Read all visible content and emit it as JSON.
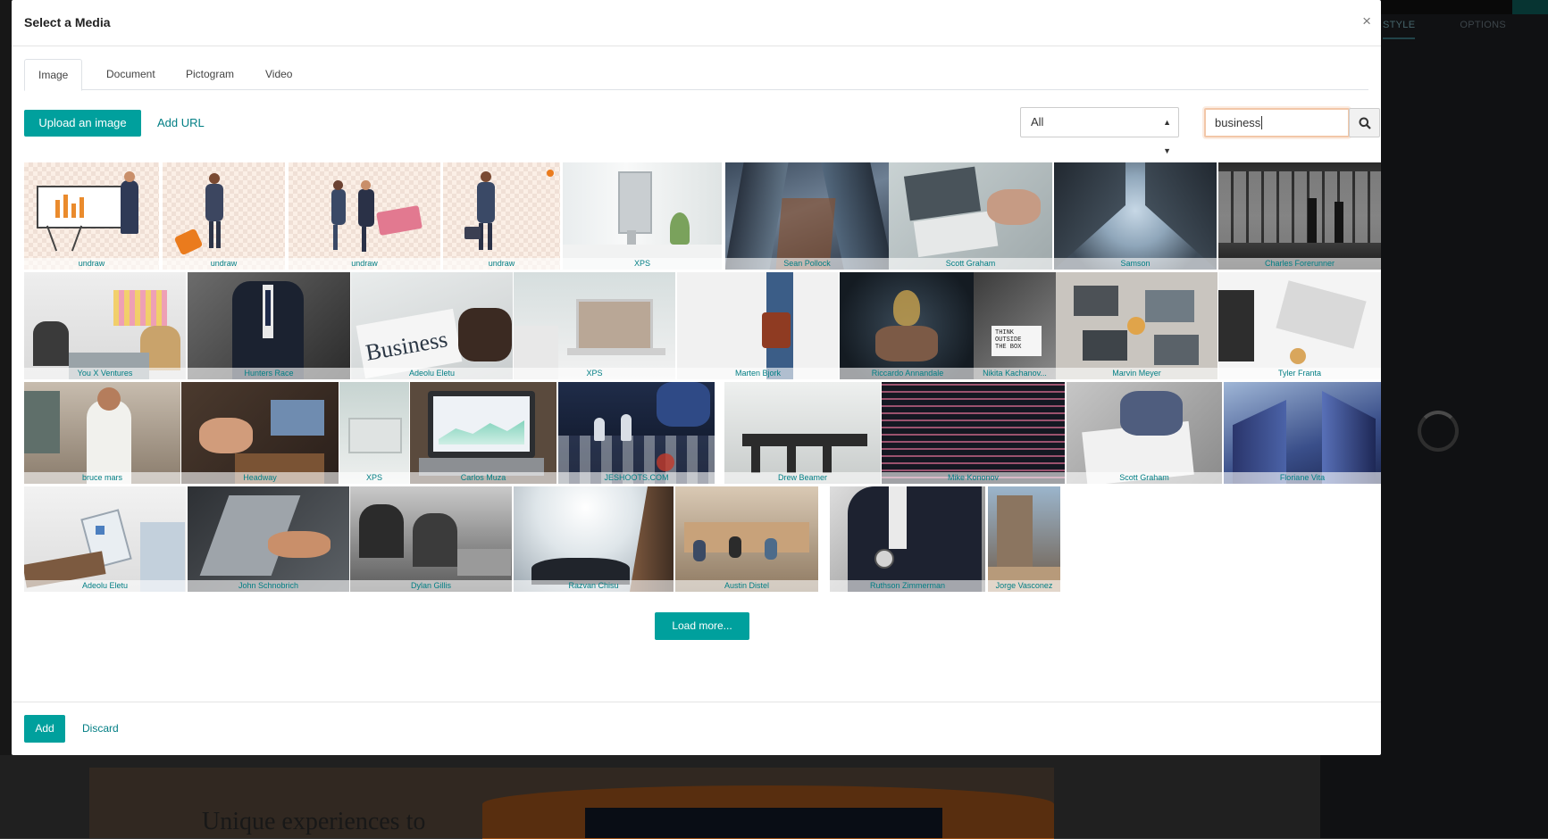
{
  "background": {
    "editor_tabs": [
      "STYLE",
      "OPTIONS"
    ],
    "heading": "Unique experiences to"
  },
  "modal": {
    "title": "Select a Media",
    "close": "×",
    "tabs": [
      "Image",
      "Document",
      "Pictogram",
      "Video"
    ],
    "active_tab": "Image",
    "upload_label": "Upload an image",
    "add_url_label": "Add URL",
    "filter_value": "All",
    "search_value": "business",
    "load_more_label": "Load more...",
    "add_label": "Add",
    "discard_label": "Discard"
  },
  "images": [
    {
      "caption": "undraw"
    },
    {
      "caption": "undraw"
    },
    {
      "caption": "undraw"
    },
    {
      "caption": "undraw"
    },
    {
      "caption": "XPS"
    },
    {
      "caption": "Sean Pollock"
    },
    {
      "caption": "Scott Graham"
    },
    {
      "caption": "Samson"
    },
    {
      "caption": "Charles Forerunner"
    },
    {
      "caption": "You X Ventures"
    },
    {
      "caption": "Hunters Race"
    },
    {
      "caption": "Adeolu Eletu"
    },
    {
      "caption": "XPS"
    },
    {
      "caption": "Marten Bjork"
    },
    {
      "caption": "Riccardo Annandale"
    },
    {
      "caption": "Nikita Kachanov..."
    },
    {
      "caption": "Marvin Meyer"
    },
    {
      "caption": "Tyler Franta"
    },
    {
      "caption": "bruce mars"
    },
    {
      "caption": "Headway"
    },
    {
      "caption": "XPS"
    },
    {
      "caption": "Carlos Muza"
    },
    {
      "caption": "JESHOOTS.COM"
    },
    {
      "caption": "Drew Beamer"
    },
    {
      "caption": "Mike Kononov"
    },
    {
      "caption": "Scott Graham"
    },
    {
      "caption": "Floriane Vita"
    },
    {
      "caption": "Adeolu Eletu"
    },
    {
      "caption": "John Schnobrich"
    },
    {
      "caption": "Dylan Gillis"
    },
    {
      "caption": "Razvan Chisu"
    },
    {
      "caption": "Austin Distel"
    },
    {
      "caption": "Ruthson Zimmerman"
    },
    {
      "caption": "Jorge Vasconez"
    }
  ],
  "colors": {
    "accent": "#00a09d",
    "link": "#017e84"
  }
}
